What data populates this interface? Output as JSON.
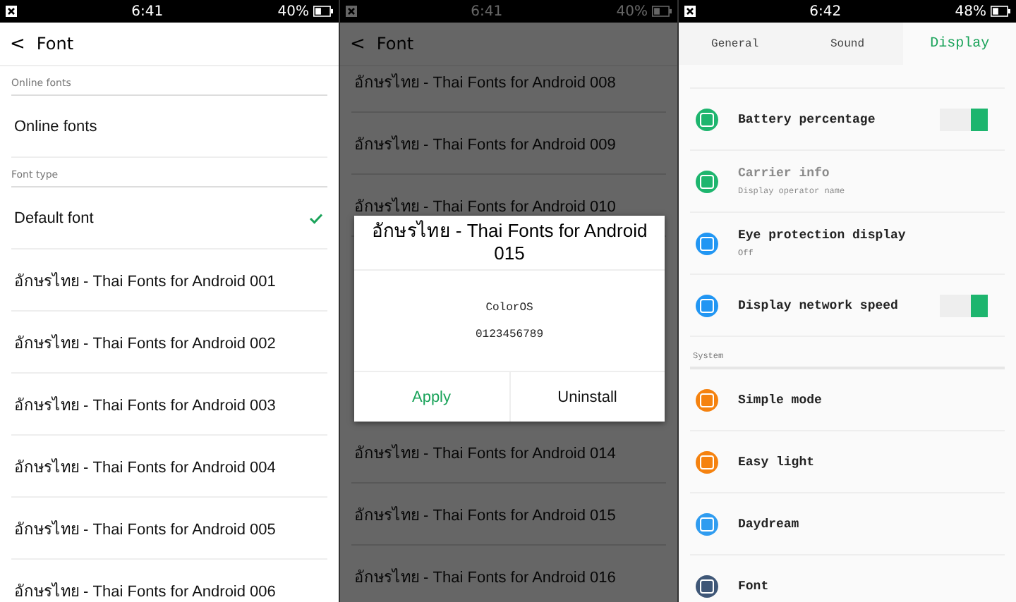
{
  "screens": [
    {
      "status_bar": {
        "time": "6:41",
        "battery": "40%"
      },
      "header": {
        "back": "<",
        "title": "Font"
      },
      "sections": [
        {
          "label": "Online fonts",
          "items": [
            {
              "label": "Online fonts",
              "selected": false
            }
          ]
        },
        {
          "label": "Font type",
          "items": [
            {
              "label": "Default font",
              "selected": true
            },
            {
              "label": "อักษรไทย - Thai Fonts for Android 001",
              "selected": false
            },
            {
              "label": "อักษรไทย - Thai Fonts for Android 002",
              "selected": false
            },
            {
              "label": "อักษรไทย - Thai Fonts for Android 003",
              "selected": false
            },
            {
              "label": "อักษรไทย - Thai Fonts for Android 004",
              "selected": false
            },
            {
              "label": "อักษรไทย - Thai Fonts for Android 005",
              "selected": false
            },
            {
              "label": "อักษรไทย - Thai Fonts for Android 006",
              "selected": false
            }
          ]
        }
      ]
    },
    {
      "status_bar": {
        "time": "6:41",
        "battery": "40%"
      },
      "header": {
        "back": "<",
        "title": "Font"
      },
      "rows_above": [
        "อักษรไทย - Thai Fonts for Android 008",
        "อักษรไทย - Thai Fonts for Android 009",
        "อักษรไทย - Thai Fonts for Android 010"
      ],
      "rows_below": [
        "อักษรไทย - Thai Fonts for Android 014",
        "อักษรไทย - Thai Fonts for Android 015",
        "อักษรไทย - Thai Fonts for Android 016"
      ],
      "dialog": {
        "title": "อักษรไทย - Thai Fonts for Android 015",
        "preview": [
          "ColorOS",
          "0123456789"
        ],
        "buttons": [
          {
            "label": "Apply",
            "kind": "primary"
          },
          {
            "label": "Uninstall",
            "kind": "normal"
          }
        ]
      }
    },
    {
      "status_bar": {
        "time": "6:42",
        "battery": "48%"
      },
      "tabs": [
        {
          "label": "General",
          "selected": false
        },
        {
          "label": "Sound",
          "selected": false
        },
        {
          "label": "Display",
          "selected": true
        }
      ],
      "groups": [
        {
          "items": [
            {
              "label": "Battery percentage",
              "color": "#1db56e",
              "kind": "toggle",
              "on": true,
              "disabled": false
            },
            {
              "label": "Carrier info",
              "subtitle": "Display operator name",
              "color": "#1db56e",
              "kind": "plain",
              "disabled": true
            },
            {
              "label": "Eye protection display",
              "subtitle": "Off",
              "color": "#2196f3",
              "kind": "plain",
              "disabled": false
            },
            {
              "label": "Display network speed",
              "color": "#2196f3",
              "kind": "toggle",
              "on": true,
              "disabled": false
            }
          ]
        },
        {
          "label": "System",
          "items": [
            {
              "label": "Simple mode",
              "color": "#f5820f",
              "kind": "plain",
              "disabled": false
            },
            {
              "label": "Easy light",
              "color": "#f5820f",
              "kind": "plain",
              "disabled": false
            },
            {
              "label": "Daydream",
              "color": "#2f9cf0",
              "kind": "plain",
              "disabled": false
            },
            {
              "label": "Font",
              "color": "#3f5777",
              "kind": "plain",
              "disabled": false
            }
          ]
        }
      ]
    }
  ]
}
